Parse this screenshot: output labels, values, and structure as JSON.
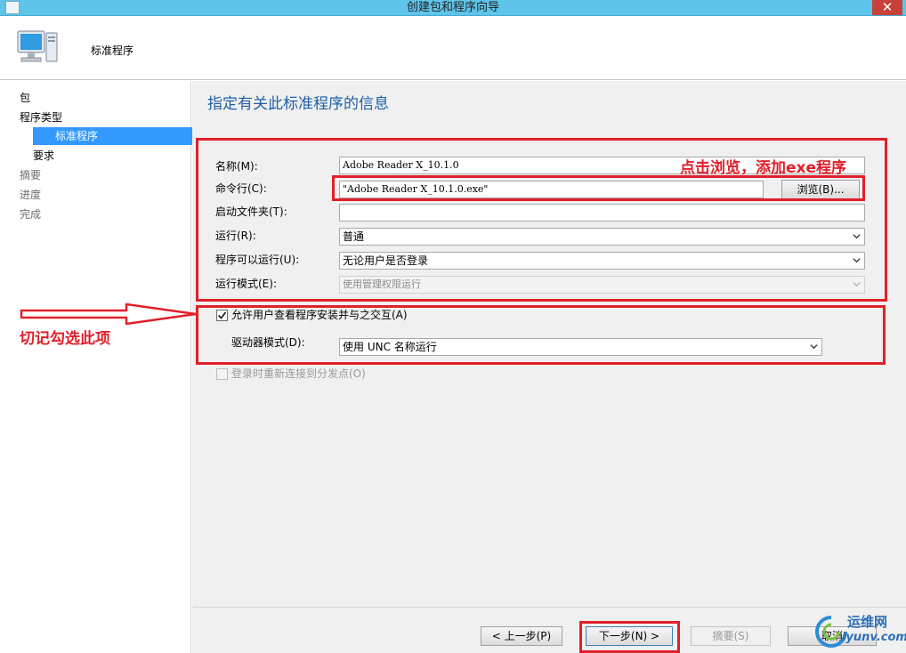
{
  "window": {
    "title": "创建包和程序向导",
    "close_symbol": "✕"
  },
  "header": {
    "title": "标准程序"
  },
  "nav": {
    "items": [
      {
        "label": "包"
      },
      {
        "label": "程序类型"
      },
      {
        "label": "标准程序"
      },
      {
        "label": "要求"
      },
      {
        "label": "摘要"
      },
      {
        "label": "进度"
      },
      {
        "label": "完成"
      }
    ],
    "selected_index": 2
  },
  "main": {
    "heading": "指定有关此标准程序的信息",
    "form": {
      "name_label": "名称(M):",
      "name_value": "Adobe Reader X_10.1.0",
      "cmd_label": "命令行(C):",
      "cmd_value": "\"Adobe Reader X_10.1.0.exe\"",
      "browse_label": "浏览(B)...",
      "startdir_label": "启动文件夹(T):",
      "startdir_value": "",
      "run_label": "运行(R):",
      "run_value": "普通",
      "canrun_label": "程序可以运行(U):",
      "canrun_value": "无论用户是否登录",
      "runmode_label": "运行模式(E):",
      "runmode_value": "使用管理权限运行",
      "allow_interact_label": "允许用户查看程序安装并与之交互(A)",
      "allow_interact_checked": true,
      "drive_mode_label": "驱动器模式(D):",
      "drive_mode_value": "使用 UNC 名称运行",
      "reconnect_label": "登录时重新连接到分发点(O)",
      "reconnect_checked": false
    }
  },
  "annotations": {
    "browse_hint": "点击浏览，添加exe程序",
    "check_hint": "切记勾选此项",
    "color": "#e0202a"
  },
  "buttons": {
    "prev": "< 上一步(P)",
    "next": "下一步(N) >",
    "summary": "摘要(S)",
    "cancel": "取消"
  },
  "watermark": {
    "cn": "运维网",
    "url": "iyunv.com"
  }
}
